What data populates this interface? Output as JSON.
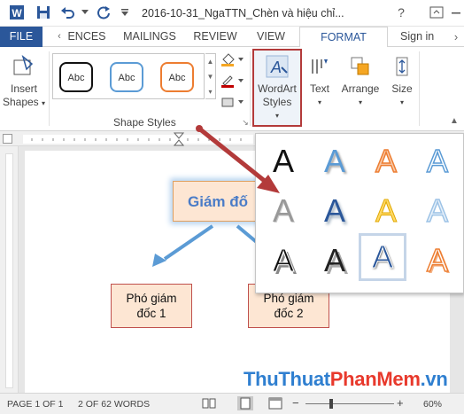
{
  "title_bar": {
    "document_title": "2016-10-31_NgaTTN_Chèn và hiệu chỉ...",
    "help_label": "?"
  },
  "tabs": {
    "file": "FILE",
    "references": "ENCES",
    "mailings": "MAILINGS",
    "review": "REVIEW",
    "view": "VIEW",
    "format": "FORMAT",
    "sign_in": "Sign in"
  },
  "ribbon": {
    "insert_shapes_line1": "Insert",
    "insert_shapes_line2": "Shapes",
    "swatch_labels": [
      "Abc",
      "Abc",
      "Abc"
    ],
    "shape_styles_label": "Shape Styles",
    "wordart_line1": "WordArt",
    "wordart_line2": "Styles",
    "text_label": "Text",
    "arrange_label": "Arrange",
    "size_label": "Size"
  },
  "diagram": {
    "top_box": "Giám đố",
    "left_box_line1": "Phó giám",
    "left_box_line2": "đốc 1",
    "right_box_line1": "Phó giám",
    "right_box_line2": "đốc 2"
  },
  "gallery": {
    "glyph": "A"
  },
  "status_bar": {
    "page": "PAGE 1 OF 1",
    "words": "2 OF 62 WORDS",
    "zoom": "60%"
  },
  "watermark": {
    "part1": "ThuThuat",
    "part2": "PhanMem",
    "part3": ".vn"
  },
  "colors": {
    "accent": "#2b579a",
    "box_fill": "#fde6d3",
    "box_border": "#c0504d",
    "connector": "#5b9bd5",
    "annotation_arrow": "#b33a3a"
  }
}
